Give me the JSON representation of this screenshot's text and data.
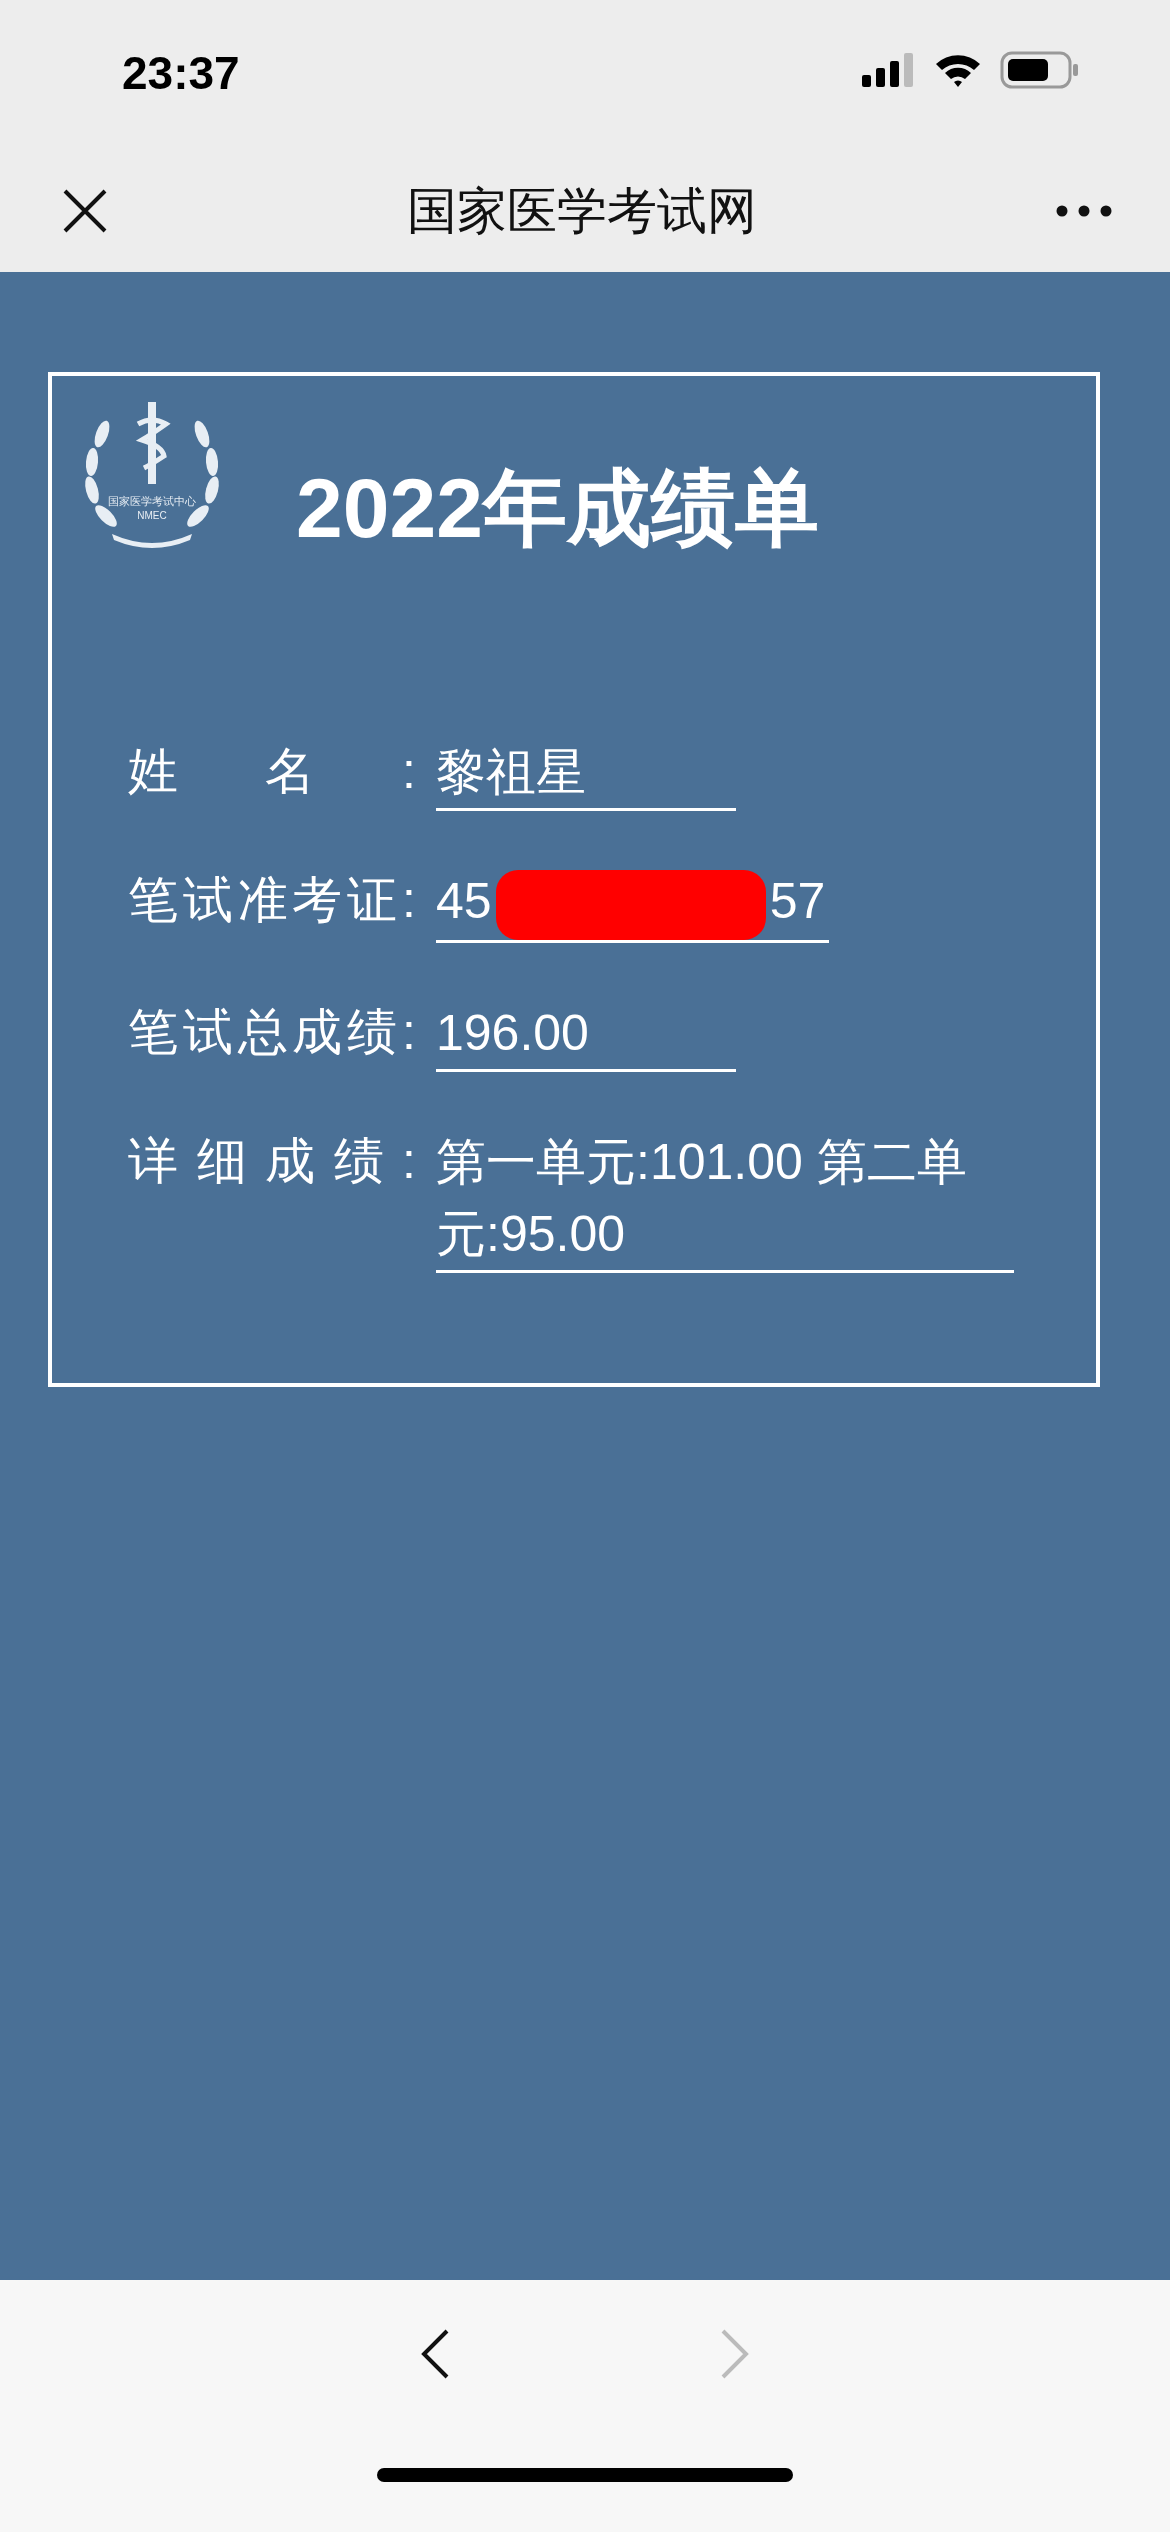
{
  "status_bar": {
    "time": "23:37"
  },
  "nav": {
    "title": "国家医学考试网"
  },
  "card": {
    "logo": {
      "name": "国家医学考试中心",
      "abbr": "NMEC"
    },
    "title": "2022年成绩单",
    "fields": [
      {
        "kind": "plain",
        "label": "姓名:",
        "value": "黎祖星"
      },
      {
        "kind": "redacted",
        "label": "笔试准考证:",
        "value_start": "45",
        "value_end": "57"
      },
      {
        "kind": "plain",
        "label": "笔试总成绩:",
        "value": "196.00"
      },
      {
        "kind": "plain",
        "label": "详细成绩:",
        "value": "第一单元:101.00 第二单元:95.00"
      }
    ]
  },
  "toolbar": {
    "back_disabled": false,
    "forward_disabled": true
  }
}
